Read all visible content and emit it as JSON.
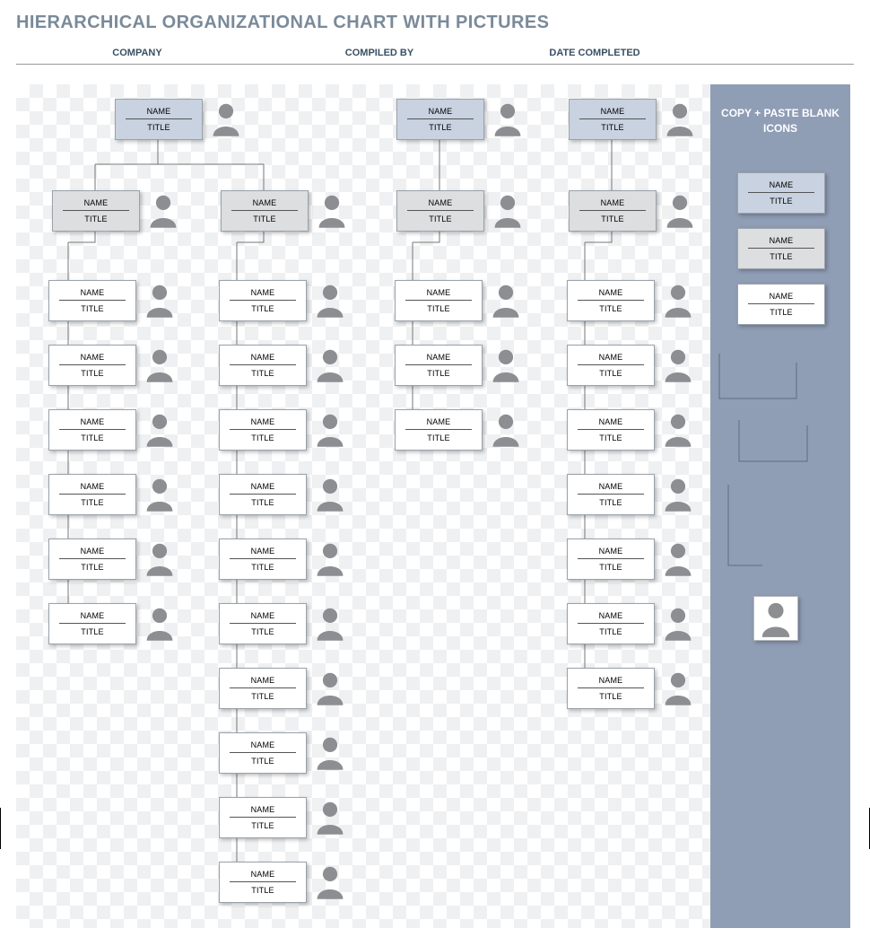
{
  "title": "HIERARCHICAL ORGANIZATIONAL CHART WITH PICTURES",
  "headers": {
    "company": "COMPANY",
    "compiledBy": "COMPILED BY",
    "dateCompleted": "DATE COMPLETED"
  },
  "sidebar": {
    "heading": "COPY + PASTE BLANK ICONS",
    "samples": [
      {
        "name": "NAME",
        "title": "TITLE",
        "level": 0
      },
      {
        "name": "NAME",
        "title": "TITLE",
        "level": 1
      },
      {
        "name": "NAME",
        "title": "TITLE",
        "level": 2
      }
    ]
  },
  "placeholder": {
    "name": "NAME",
    "title": "TITLE"
  },
  "branches": [
    {
      "topX": 110,
      "mgrX": [
        40,
        228
      ],
      "childX": 36,
      "children": 6,
      "children2X": 226,
      "children2": 10,
      "single": false
    },
    {
      "topX": 424,
      "mgrX": [
        424
      ],
      "childX": 422,
      "children": 3,
      "single": true
    },
    {
      "topX": 616,
      "mgrX": [
        616
      ],
      "childX": 614,
      "children": 7,
      "single": true
    }
  ],
  "geom": {
    "topY": 16,
    "mgrY": 118,
    "childStartY": 218,
    "childGap": 72
  }
}
